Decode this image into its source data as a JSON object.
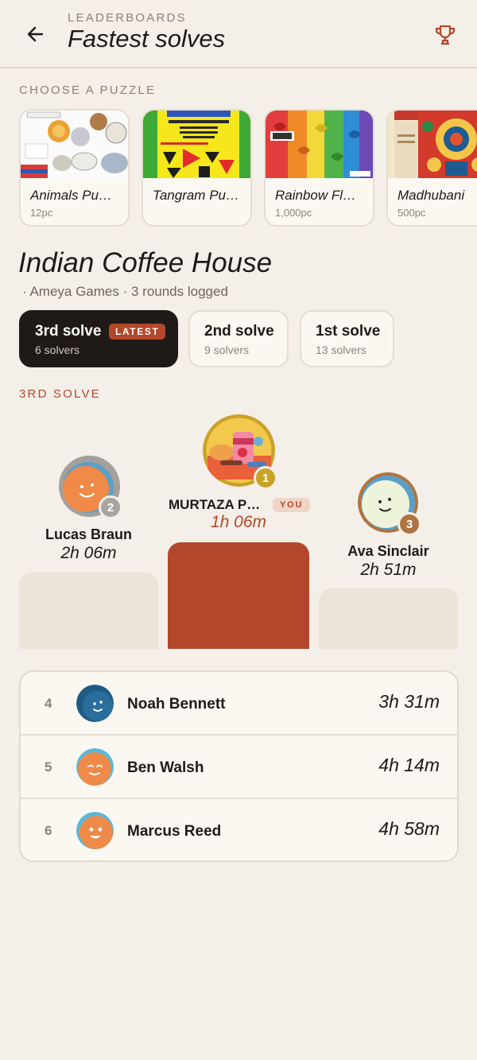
{
  "header": {
    "eyebrow": "LEADERBOARDS",
    "title": "Fastest solves",
    "back_icon": "arrow-left-icon",
    "trophy_icon": "trophy-icon"
  },
  "picker": {
    "label": "CHOOSE A PUZZLE",
    "puzzles": [
      {
        "name": "Animals Pu…",
        "pieces": "12pc"
      },
      {
        "name": "Tangram Pu…",
        "pieces": ""
      },
      {
        "name": "Rainbow Fl…",
        "pieces": "1,000pc"
      },
      {
        "name": "Madhubani",
        "pieces": "500pc"
      }
    ]
  },
  "puzzle": {
    "title": "Indian Coffee House",
    "subtitle": "· Ameya Games · 3 rounds logged"
  },
  "rounds": [
    {
      "label": "3rd solve",
      "badge": "LATEST",
      "solvers": "6 solvers"
    },
    {
      "label": "2nd solve",
      "solvers": "9 solvers"
    },
    {
      "label": "1st solve",
      "solvers": "13 solvers"
    }
  ],
  "round_heading": "3RD SOLVE",
  "podium": {
    "first": {
      "name": "MURTAZA P…",
      "badge": "YOU",
      "time": "1h 06m",
      "rank": "1"
    },
    "second": {
      "name": "Lucas Braun",
      "time": "2h 06m",
      "rank": "2"
    },
    "third": {
      "name": "Ava Sinclair",
      "time": "2h 51m",
      "rank": "3"
    }
  },
  "rest": [
    {
      "rank": "4",
      "name": "Noah Bennett",
      "time": "3h 31m"
    },
    {
      "rank": "5",
      "name": "Ben Walsh",
      "time": "4h 14m"
    },
    {
      "rank": "6",
      "name": "Marcus Reed",
      "time": "4h 58m"
    }
  ],
  "colors": {
    "accent": "#b3472b",
    "gold": "#c9a227",
    "silver": "#a9a5a1",
    "bronze": "#b07440",
    "background": "#f4efe8"
  }
}
